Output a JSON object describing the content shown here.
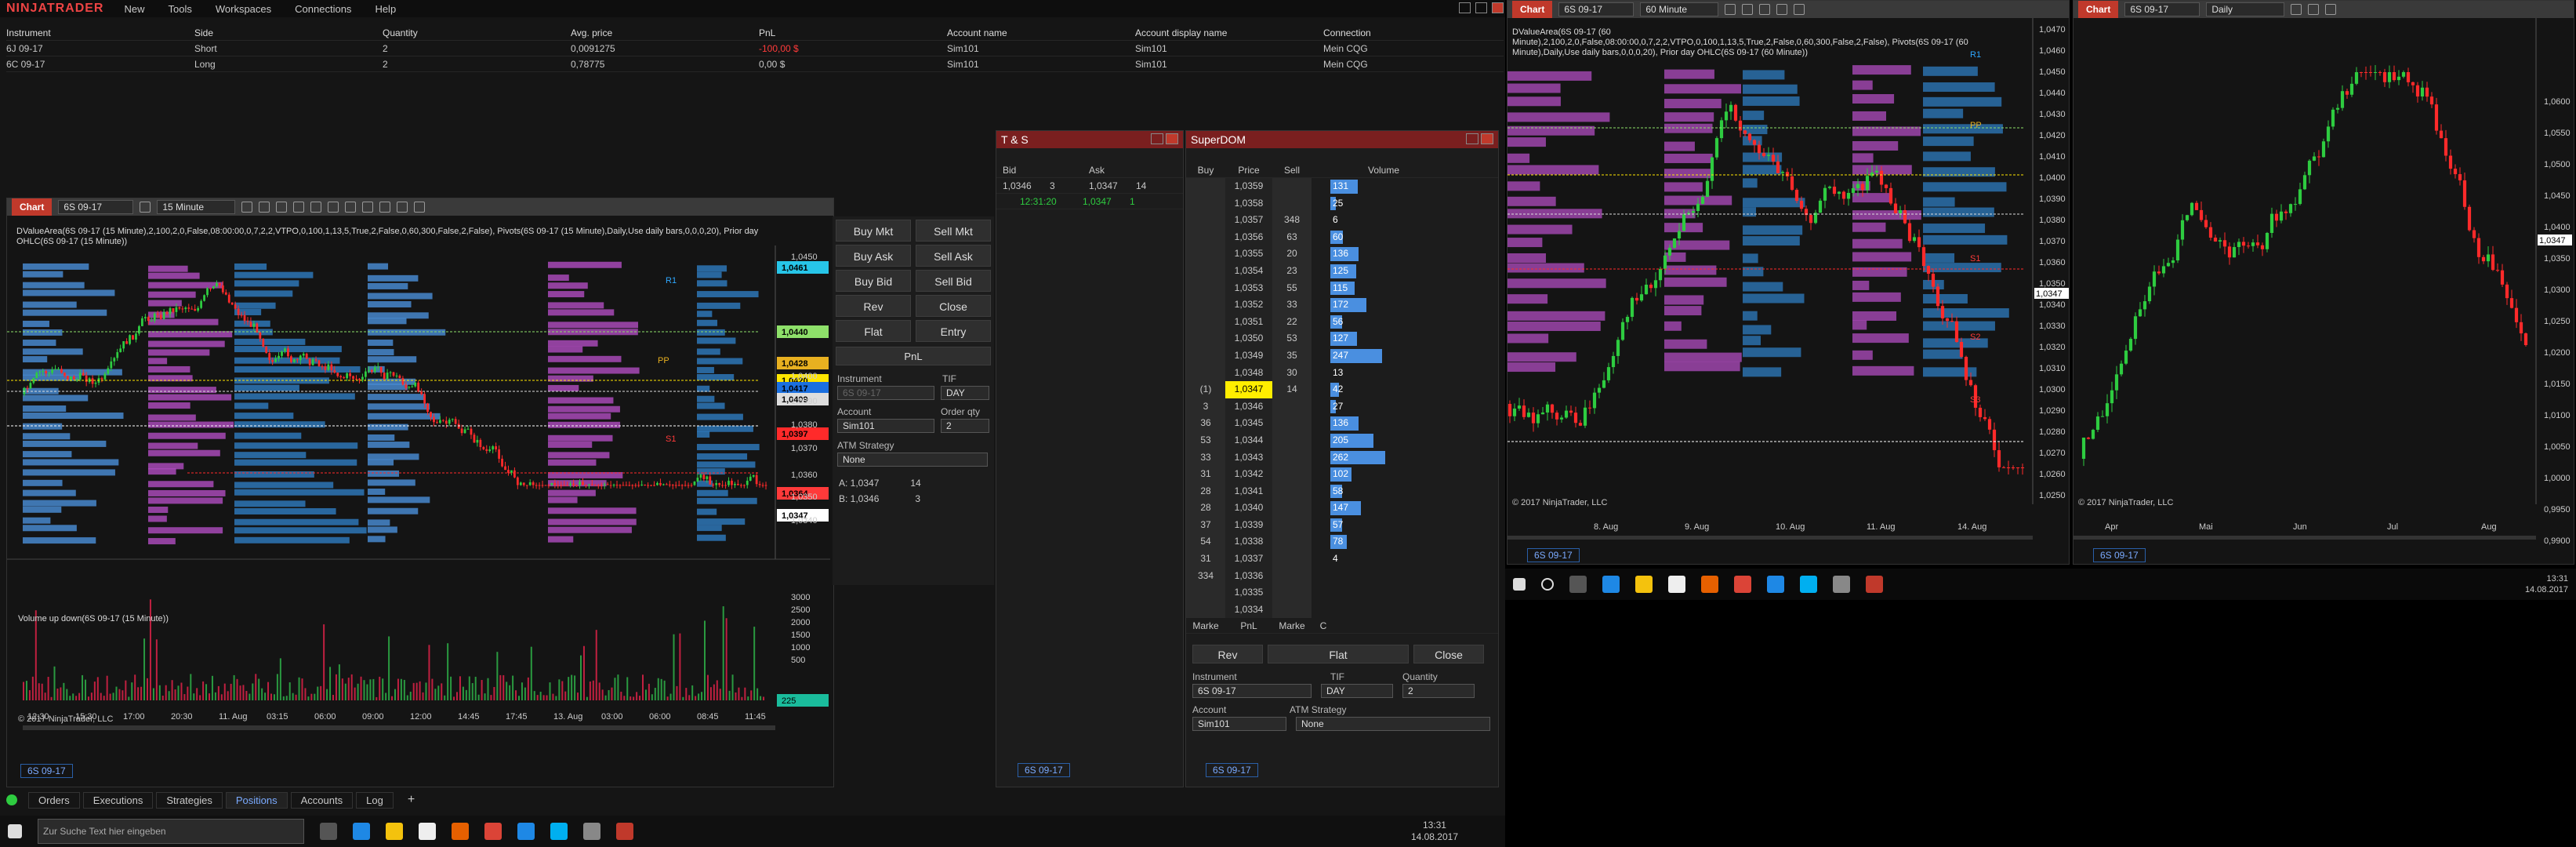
{
  "app": {
    "logo": "NINJATRADER",
    "menu": [
      "New",
      "Tools",
      "Workspaces",
      "Connections",
      "Help"
    ]
  },
  "positions": {
    "headers": [
      "Instrument",
      "Side",
      "Quantity",
      "Avg. price",
      "PnL",
      "Account name",
      "Account display name",
      "Connection"
    ],
    "rows": [
      [
        "6J 09-17",
        "Short",
        "2",
        "0,0091275",
        "-100,00 $",
        "Sim101",
        "Sim101",
        "Mein CQG"
      ],
      [
        "6C 09-17",
        "Long",
        "2",
        "0,78775",
        "0,00 $",
        "Sim101",
        "Sim101",
        "Mein CQG"
      ]
    ]
  },
  "chart1": {
    "tab": "Chart",
    "instrument": "6S 09-17",
    "interval": "15 Minute",
    "info": "DValueArea(6S 09-17 (15 Minute),2,100,2,0,False,08:00:00,0,7,2,2,VTPO,0,100,1,13,5,True,2,False,0,60,300,False,2,False), Pivots(6S 09-17 (15 Minute),Daily,Use daily bars,0,0,0,20), Prior day OHLC(6S 09-17 (15 Minute))",
    "price_tags": [
      {
        "v": "1,0461",
        "c": "#27c5e8"
      },
      {
        "v": "1,0440",
        "c": "#8ee06a"
      },
      {
        "v": "1,0428",
        "c": "#e8b020"
      },
      {
        "v": "1,0420",
        "c": "#ffe600"
      },
      {
        "v": "1,0417",
        "c": "#1a6fe0"
      },
      {
        "v": "1,0409",
        "c": "#dddddd"
      },
      {
        "v": "1,0397",
        "c": "#ff2a2a"
      },
      {
        "v": "1,0364",
        "c": "#ff3a3a"
      },
      {
        "v": "1,0347",
        "c": "#ffffff"
      }
    ],
    "axis": [
      "1,0460",
      "1,0450",
      "1,0400",
      "1,0390",
      "1,0380",
      "1,0370",
      "1,0360",
      "1,0350",
      "1,0340"
    ],
    "labels": [
      "R1",
      "PP",
      "S1"
    ],
    "sub_title": "Volume up down(6S 09-17 (15 Minute))",
    "sub_axis": [
      "3000",
      "2500",
      "2000",
      "1500",
      "1000",
      "500"
    ],
    "sub_tag": "225",
    "copyright": "© 2017 NinjaTrader, LLC",
    "time_axis": [
      "12:30",
      "15:30",
      "17:00",
      "20:30",
      "11. Aug",
      "03:15",
      "06:00",
      "09:00",
      "12:00",
      "14:45",
      "17:45",
      "13. Aug",
      "03:00",
      "06:00",
      "08:45",
      "11:45"
    ],
    "footer_tab": "6S 09-17"
  },
  "order": {
    "buttons": [
      [
        "Buy Mkt",
        "Sell Mkt"
      ],
      [
        "Buy Ask",
        "Sell Ask"
      ],
      [
        "Buy Bid",
        "Sell Bid"
      ],
      [
        "Rev",
        "Close"
      ],
      [
        "Flat",
        "Entry"
      ]
    ],
    "pnl": "PnL",
    "instrument_label": "Instrument",
    "instrument": "6S 09-17",
    "tif_label": "TIF",
    "tif": "DAY",
    "account_label": "Account",
    "account": "Sim101",
    "qty_label": "Order qty",
    "qty": "2",
    "atm_label": "ATM Strategy",
    "atm": "None",
    "ask": "A: 1,0347",
    "ask_q": "14",
    "bid": "B: 1,0346",
    "bid_q": "3"
  },
  "ts": {
    "title": "T & S",
    "bid_h": "Bid",
    "ask_h": "Ask",
    "bid": "1,0346",
    "bid_q": "3",
    "ask": "1,0347",
    "ask_q": "14",
    "time": "12:31:20",
    "price": "1,0347",
    "qty": "1",
    "footer_tab": "6S 09-17"
  },
  "dom": {
    "title": "SuperDOM",
    "headers": [
      "Buy",
      "Price",
      "Sell",
      "Volume"
    ],
    "rows": [
      [
        "",
        "1,0359",
        "",
        "131"
      ],
      [
        "",
        "1,0358",
        "",
        "25"
      ],
      [
        "",
        "1,0357",
        "348",
        "6"
      ],
      [
        "",
        "1,0356",
        "63",
        "60"
      ],
      [
        "",
        "1,0355",
        "20",
        "136"
      ],
      [
        "",
        "1,0354",
        "23",
        "125"
      ],
      [
        "",
        "1,0353",
        "55",
        "115"
      ],
      [
        "",
        "1,0352",
        "33",
        "172"
      ],
      [
        "",
        "1,0351",
        "22",
        "56"
      ],
      [
        "",
        "1,0350",
        "53",
        "127"
      ],
      [
        "",
        "1,0349",
        "35",
        "247"
      ],
      [
        "",
        "1,0348",
        "30",
        "13"
      ],
      [
        "(1)",
        "1,0347",
        "14",
        "42"
      ],
      [
        "3",
        "1,0346",
        "",
        "27"
      ],
      [
        "36",
        "1,0345",
        "",
        "136"
      ],
      [
        "53",
        "1,0344",
        "",
        "205"
      ],
      [
        "33",
        "1,0343",
        "",
        "262"
      ],
      [
        "31",
        "1,0342",
        "",
        "102"
      ],
      [
        "28",
        "1,0341",
        "",
        "58"
      ],
      [
        "28",
        "1,0340",
        "",
        "147"
      ],
      [
        "37",
        "1,0339",
        "",
        "57"
      ],
      [
        "54",
        "1,0338",
        "",
        "78"
      ],
      [
        "31",
        "1,0337",
        "",
        "4"
      ],
      [
        "334",
        "1,0336",
        "",
        ""
      ],
      [
        "",
        "1,0335",
        "",
        ""
      ],
      [
        "",
        "1,0334",
        "",
        ""
      ]
    ],
    "foot": [
      "Marke",
      "PnL",
      "Marke",
      "C"
    ],
    "rev": "Rev",
    "flat": "Flat",
    "close": "Close",
    "instrument_label": "Instrument",
    "instrument": "6S 09-17",
    "tif_label": "TIF",
    "tif": "DAY",
    "qty_label": "Quantity",
    "qty": "2",
    "account_label": "Account",
    "account": "Sim101",
    "atm_label": "ATM Strategy",
    "atm": "None",
    "footer_tab": "6S 09-17"
  },
  "chart2": {
    "tab": "Chart",
    "instrument": "6S 09-17",
    "interval": "60 Minute",
    "info": "DValueArea(6S 09-17 (60 Minute),2,100,2,0,False,08:00:00,0,7,2,2,VTPO,0,100,1,13,5,True,2,False,0,60,300,False,2,False), Pivots(6S 09-17 (60 Minute),Daily,Use daily bars,0,0,0,20), Prior day OHLC(6S 09-17 (60 Minute))",
    "axis": [
      "1,0470",
      "1,0460",
      "1,0450",
      "1,0440",
      "1,0430",
      "1,0420",
      "1,0410",
      "1,0400",
      "1,0390",
      "1,0380",
      "1,0370",
      "1,0360",
      "1,0350",
      "1,0340",
      "1,0330",
      "1,0320",
      "1,0310",
      "1,0300",
      "1,0290",
      "1,0280",
      "1,0270",
      "1,0260",
      "1,0250"
    ],
    "tag": "1,0347",
    "labels": [
      "R1",
      "PP",
      "S1",
      "S2",
      "S3"
    ],
    "time_axis": [
      "8. Aug",
      "9. Aug",
      "10. Aug",
      "11. Aug",
      "14. Aug"
    ],
    "copyright": "© 2017 NinjaTrader, LLC",
    "footer_tab": "6S 09-17"
  },
  "chart3": {
    "tab": "Chart",
    "instrument": "6S 09-17",
    "interval": "Daily",
    "axis": [
      "1,0600",
      "1,0550",
      "1,0500",
      "1,0450",
      "1,0400",
      "1,0350",
      "1,0300",
      "1,0250",
      "1,0200",
      "1,0150",
      "1,0100",
      "1,0050",
      "1,0000",
      "0,9950",
      "0,9900"
    ],
    "tag": "1,0347",
    "time_axis": [
      "Apr",
      "Mai",
      "Jun",
      "Jul",
      "Aug"
    ],
    "copyright": "© 2017 NinjaTrader, LLC",
    "footer_tab": "6S 09-17"
  },
  "control_tabs": [
    "Orders",
    "Executions",
    "Strategies",
    "Positions",
    "Accounts",
    "Log"
  ],
  "taskbar_left": {
    "search": "Zur Suche Text hier eingeben",
    "time": "13:31",
    "date": "14.08.2017"
  },
  "taskbar_right": {
    "time": "13:31",
    "date": "14.08.2017"
  }
}
